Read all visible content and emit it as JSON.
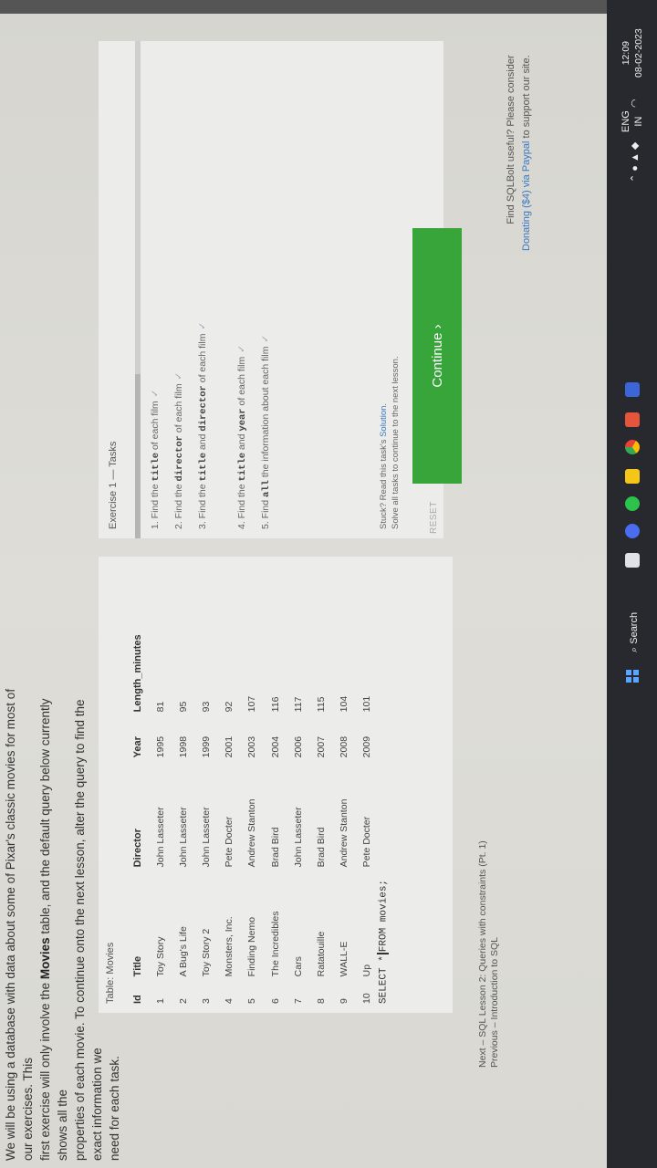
{
  "intro": {
    "line1": "We will be using a database with data about some of Pixar's classic movies for most of our exercises. This",
    "line2a": "first exercise will only involve the ",
    "line2b": "Movies",
    "line2c": " table, and the default query below currently shows all the",
    "line3": "properties of each movie. To continue onto the next lesson, alter the query to find the exact information we",
    "line4": "need for each task."
  },
  "table": {
    "label": "Table: Movies",
    "headers": [
      "Id",
      "Title",
      "Director",
      "Year",
      "Length_minutes"
    ],
    "rows": [
      [
        "1",
        "Toy Story",
        "John Lasseter",
        "1995",
        "81"
      ],
      [
        "2",
        "A Bug's Life",
        "John Lasseter",
        "1998",
        "95"
      ],
      [
        "3",
        "Toy Story 2",
        "John Lasseter",
        "1999",
        "93"
      ],
      [
        "4",
        "Monsters, Inc.",
        "Pete Docter",
        "2001",
        "92"
      ],
      [
        "5",
        "Finding Nemo",
        "Andrew Stanton",
        "2003",
        "107"
      ],
      [
        "6",
        "The Incredibles",
        "Brad Bird",
        "2004",
        "116"
      ],
      [
        "7",
        "Cars",
        "John Lasseter",
        "2006",
        "117"
      ],
      [
        "8",
        "Ratatouille",
        "Brad Bird",
        "2007",
        "115"
      ],
      [
        "9",
        "WALL-E",
        "Andrew Stanton",
        "2008",
        "104"
      ],
      [
        "10",
        "Up",
        "Pete Docter",
        "2009",
        "101"
      ]
    ]
  },
  "query": {
    "part1": "SELECT *",
    "part2": "FROM movies;"
  },
  "exercise": {
    "title": "Exercise 1 — Tasks",
    "tasks": [
      {
        "pre": "1. Find the ",
        "code": "title",
        "post": " of each film"
      },
      {
        "pre": "2. Find the ",
        "code": "director",
        "post": " of each film"
      },
      {
        "pre": "3. Find the ",
        "code": "title",
        "mid": " and ",
        "code2": "director",
        "post": " of each film"
      },
      {
        "pre": "4. Find the ",
        "code": "title",
        "mid": " and ",
        "code2": "year",
        "post": " of each film"
      },
      {
        "pre": "5. Find ",
        "code": "all",
        "post": " the information about each film"
      }
    ],
    "check": "✓",
    "stuck_a": "Stuck? Read this task's ",
    "stuck_link": "Solution.",
    "stuck_b": "Solve all tasks to continue to the next lesson."
  },
  "buttons": {
    "reset": "RESET",
    "continue": "Continue ›"
  },
  "nav": {
    "next": "Next – SQL Lesson 2: Queries with constraints (Pt. 1)",
    "previous": "Previous – Introduction to SQL"
  },
  "support": {
    "line1": "Find SQLBolt useful? Please consider",
    "donate": "Donating ($4) via Paypal",
    "line2": " to support our site."
  },
  "taskbar": {
    "search": "Search",
    "lang1": "ENG",
    "lang2": "IN",
    "time": "12:09",
    "date": "08-02-2023"
  }
}
